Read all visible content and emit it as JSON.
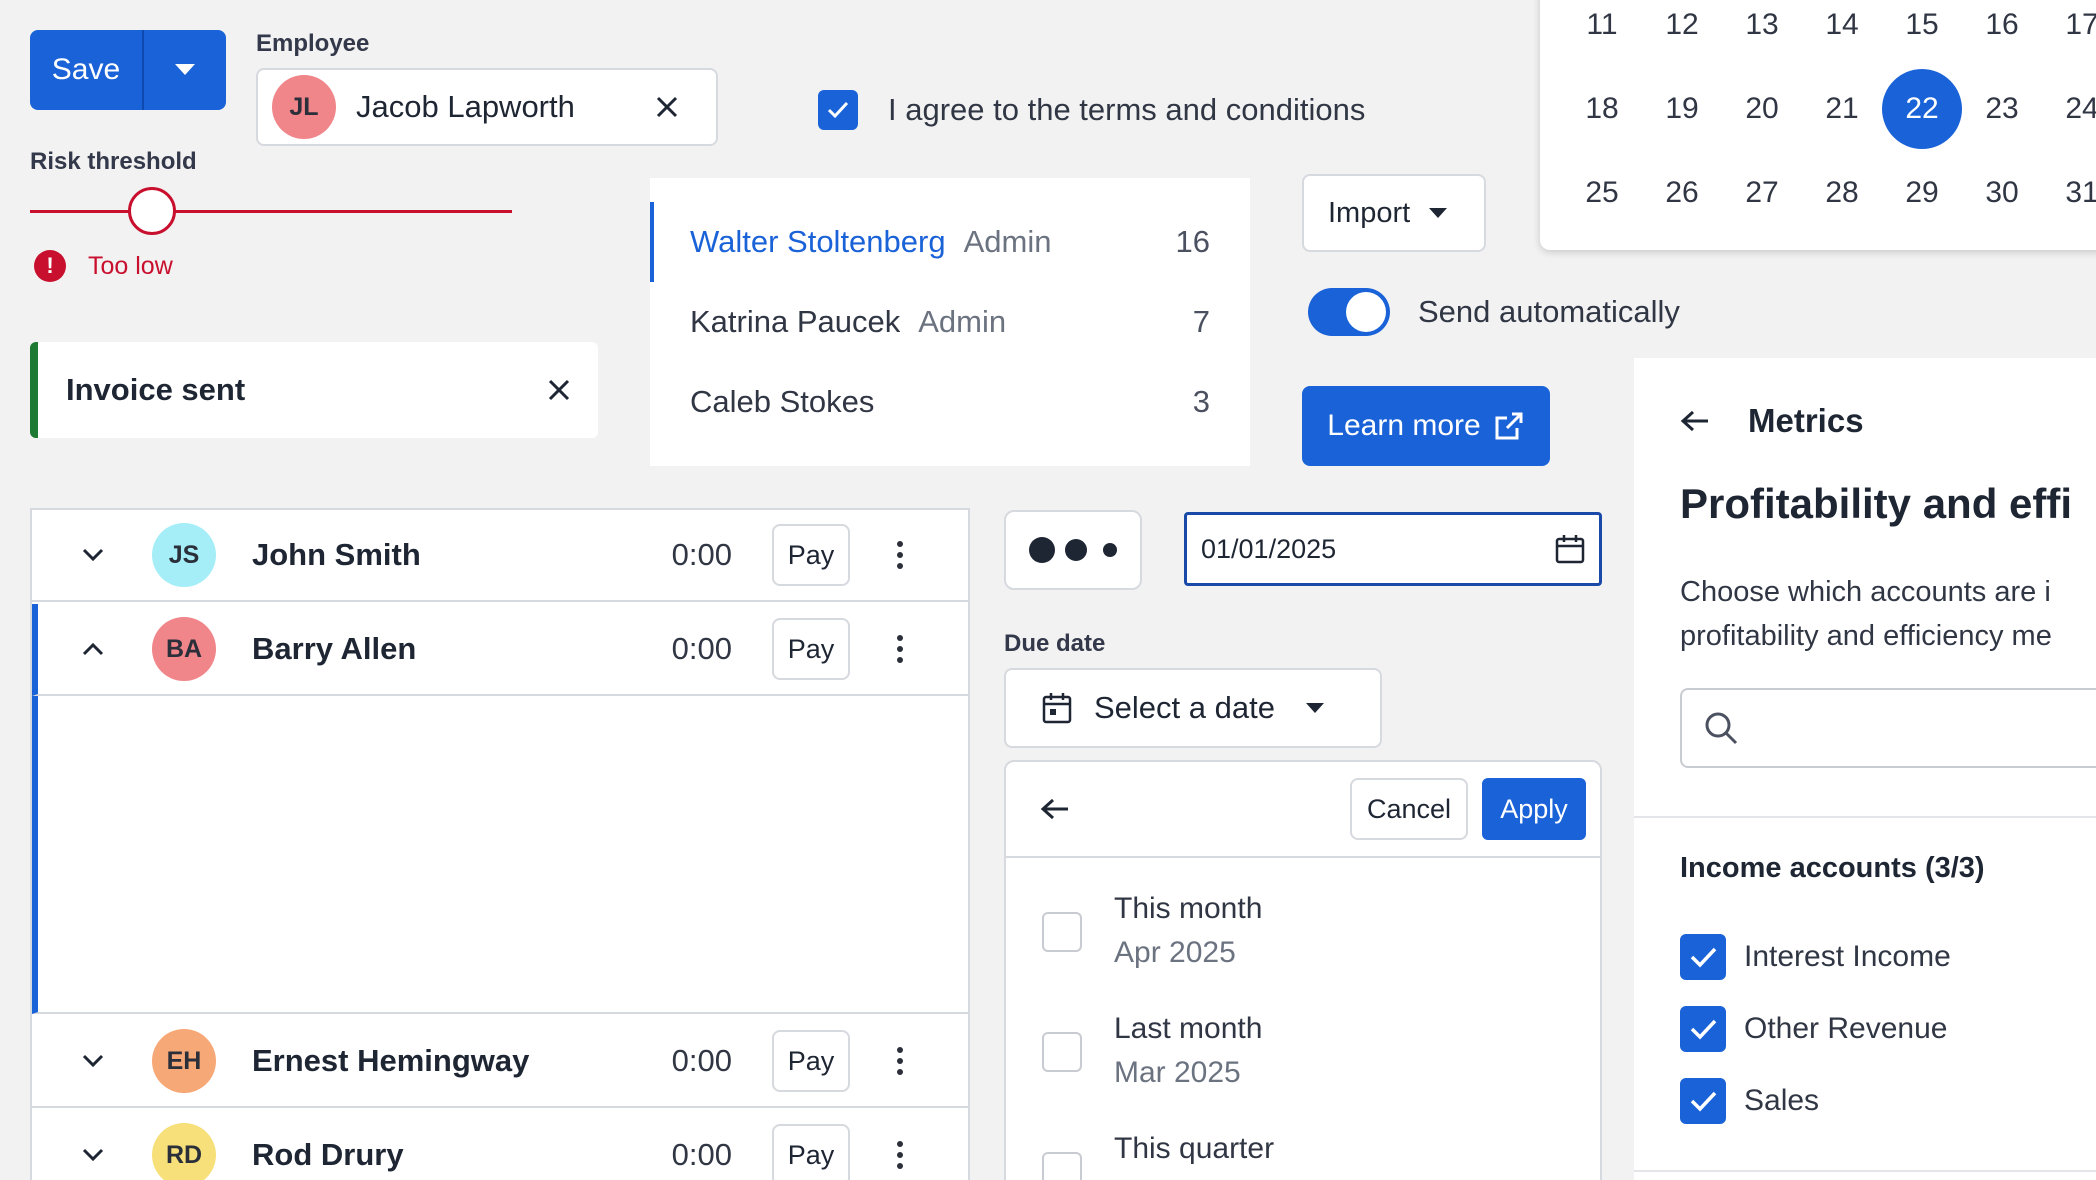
{
  "save_button": {
    "label": "Save"
  },
  "employee": {
    "label": "Employee",
    "initials": "JL",
    "name": "Jacob Lapworth",
    "avatar_color": "#f0858a"
  },
  "terms": {
    "label": "I agree to the terms and conditions",
    "checked": true
  },
  "risk": {
    "label": "Risk threshold",
    "error_text": "Too low",
    "level_fraction": 0.2
  },
  "toast": {
    "text": "Invoice sent",
    "accent": "#1d7a33"
  },
  "users": [
    {
      "name": "Walter Stoltenberg",
      "role": "Admin",
      "count": "16",
      "active": true
    },
    {
      "name": "Katrina Paucek",
      "role": "Admin",
      "count": "7",
      "active": false
    },
    {
      "name": "Caleb Stokes",
      "role": "",
      "count": "3",
      "active": false
    }
  ],
  "import_button": {
    "label": "Import"
  },
  "send_toggle": {
    "label": "Send automatically",
    "on": true
  },
  "learn_more": {
    "label": "Learn more"
  },
  "calendar": {
    "weeks": [
      [
        "11",
        "12",
        "13",
        "14",
        "15",
        "16",
        "17"
      ],
      [
        "18",
        "19",
        "20",
        "21",
        "22",
        "23",
        "24"
      ],
      [
        "25",
        "26",
        "27",
        "28",
        "29",
        "30",
        "31"
      ]
    ],
    "selected": "22"
  },
  "payroll": {
    "rows": [
      {
        "initials": "JS",
        "name": "John Smith",
        "time": "0:00",
        "pay_label": "Pay",
        "avatar_color": "#a5eef7",
        "expanded": false
      },
      {
        "initials": "BA",
        "name": "Barry Allen",
        "time": "0:00",
        "pay_label": "Pay",
        "avatar_color": "#f0858a",
        "expanded": true
      },
      {
        "initials": "EH",
        "name": "Ernest Hemingway",
        "time": "0:00",
        "pay_label": "Pay",
        "avatar_color": "#f7a877",
        "expanded": false
      },
      {
        "initials": "RD",
        "name": "Rod Drury",
        "time": "0:00",
        "pay_label": "Pay",
        "avatar_color": "#f7df7a",
        "expanded": false
      }
    ]
  },
  "date_input": {
    "value": "01/01/2025"
  },
  "due_date": {
    "label": "Due date",
    "select_label": "Select a date",
    "cancel_label": "Cancel",
    "apply_label": "Apply",
    "options": [
      {
        "title": "This month",
        "sub": "Apr 2025"
      },
      {
        "title": "Last month",
        "sub": "Mar 2025"
      },
      {
        "title": "This quarter",
        "sub": ""
      }
    ]
  },
  "metrics": {
    "back_title": "Metrics",
    "heading": "Profitability and effi",
    "description_line1": "Choose which accounts are i",
    "description_line2": "profitability and efficiency me",
    "income_title": "Income accounts (3/3)",
    "accounts": [
      "Interest Income",
      "Other Revenue",
      "Sales"
    ]
  },
  "colors": {
    "primary": "#1a62d8",
    "error": "#c8102e",
    "success": "#1d7a33"
  },
  "icons": {
    "save_dropdown": "chevron-down-icon",
    "clear": "close-icon",
    "error": "exclamation-icon",
    "external": "external-link-icon",
    "calendar": "calendar-icon",
    "back": "arrow-left-icon",
    "search": "search-icon"
  }
}
